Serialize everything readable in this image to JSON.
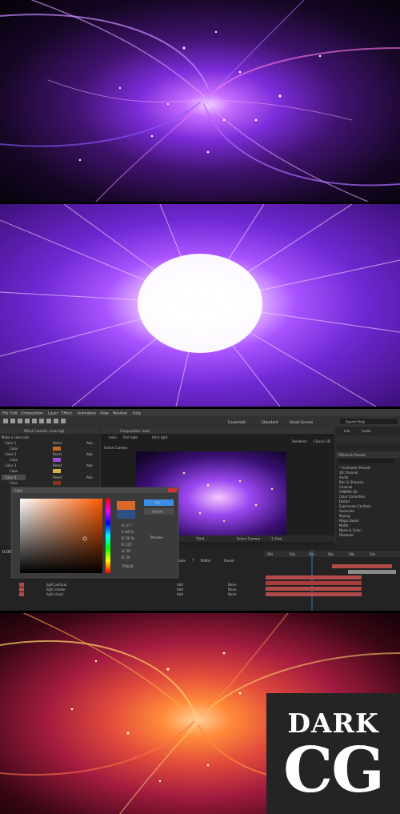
{
  "ae": {
    "menu": [
      "File",
      "Edit",
      "Composition",
      "Layer",
      "Effect",
      "Animation",
      "View",
      "Window",
      "Help"
    ],
    "workspaces": [
      "Essentials",
      "Standard",
      "Small Screen"
    ],
    "search_placeholder": "Search Help",
    "effect_controls_title": "Effect Controls: color bg2",
    "composition_title": "Composition: main",
    "comp_tabs": [
      "main",
      "first light",
      "third light"
    ],
    "viewer_label": "Active Camera",
    "renderer": "Renderer:",
    "renderer_value": "Classic 3D",
    "viewer_bottom": [
      "Third",
      "Active Camera",
      "1 View"
    ],
    "effects_panel_title": "Effects & Presets",
    "info_tabs": [
      "Info",
      "Audio"
    ],
    "effects_list": [
      "* Animation Presets",
      "3D Channel",
      "Audio",
      "Blur & Sharpen",
      "Channel",
      "CINEMA 4D",
      "Color Correction",
      "Distort",
      "Expression Controls",
      "Generate",
      "Keying",
      "Magic Bullet",
      "Matte",
      "Noise & Grain",
      "Obsolete"
    ],
    "effect_rows": [
      {
        "name": "Make a color skin",
        "fx": ""
      },
      {
        "name": "Color 1",
        "fx": "Reset",
        "about": "Abo"
      },
      {
        "name": "Color",
        "fx": ""
      },
      {
        "name": "Color 2",
        "fx": "Reset",
        "about": "Abo"
      },
      {
        "name": "Color",
        "fx": ""
      },
      {
        "name": "Color 3",
        "fx": "Reset",
        "about": "Abo"
      },
      {
        "name": "Color",
        "fx": ""
      },
      {
        "name": "Color 4",
        "fx": "Reset",
        "about": "Abo"
      },
      {
        "name": "Color",
        "fx": ""
      },
      {
        "name": "Color 5",
        "fx": "Reset",
        "about": "Abo"
      }
    ],
    "color_dialog": {
      "title": "Color",
      "ok": "OK",
      "cancel": "Cancel",
      "eyedropper": "Preview",
      "hex": "7f3b18",
      "fields": [
        "H: 21 °",
        "S: 85 %",
        "B: 50 %",
        "R: 127",
        "G: 59",
        "B: 24"
      ]
    },
    "timeline_time": "0:00:",
    "timeline_cols": [
      "Mode",
      "T",
      "TrkMat",
      "Parent"
    ],
    "timeline_layers": [
      {
        "name": "light particul",
        "mode": "Add",
        "parent": "None"
      },
      {
        "name": "light smoke",
        "mode": "Add",
        "parent": "None"
      },
      {
        "name": "light cloud",
        "mode": "Add",
        "parent": "None"
      }
    ],
    "ruler": [
      "00s",
      "02s",
      "04s",
      "06s",
      "08s",
      "10s"
    ]
  },
  "watermark": {
    "line1": "DARK",
    "line2": "CG"
  },
  "colors": {
    "ae_panel": "#2b2b2b",
    "ae_dark": "#1e1e1e",
    "ae_accent": "#3a8ee6",
    "layer_bar": "#b24a4a",
    "purple": "#9a4bff",
    "orange": "#ff7a2e"
  }
}
